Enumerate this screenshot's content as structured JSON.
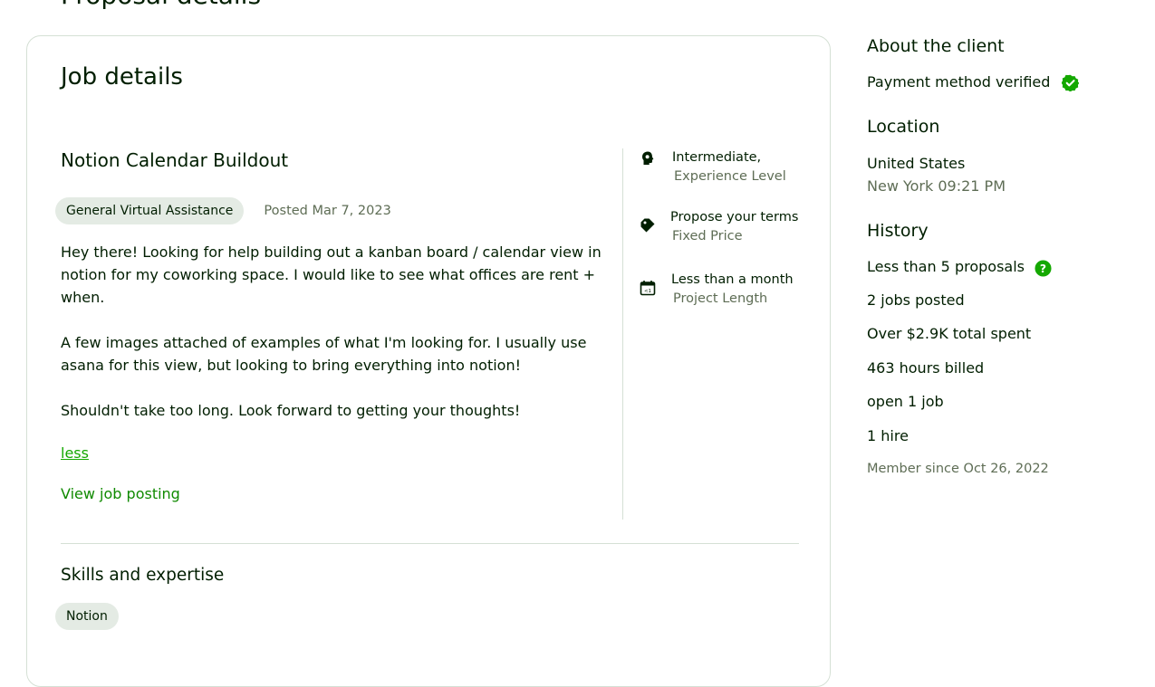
{
  "page": {
    "heading": "Proposal details"
  },
  "job": {
    "section_title": "Job details",
    "title": "Notion Calendar Buildout",
    "category": "General Virtual Assistance",
    "posted": "Posted Mar 7, 2023",
    "description": [
      "Hey there! Looking for help building out a kanban board / calendar view in notion for my coworking space. I would like to see what offices are rent + when.",
      "A few images attached of examples of what I'm looking for. I usually use asana for this view, but looking to bring everything into notion!",
      "Shouldn't take too long. Look forward to getting your thoughts!"
    ],
    "less_label": "less",
    "view_posting_label": "View job posting",
    "side": [
      {
        "icon": "experience-level-icon",
        "title": "Intermediate,",
        "subtitle": "Experience Level"
      },
      {
        "icon": "price-tag-icon",
        "title": "Propose your terms",
        "subtitle": "Fixed Price"
      },
      {
        "icon": "calendar-icon",
        "title": "Less than a month",
        "subtitle": "Project Length"
      }
    ],
    "skills_title": "Skills and expertise",
    "skills": [
      "Notion"
    ]
  },
  "client": {
    "about_title": "About the client",
    "payment": "Payment method verified",
    "location_title": "Location",
    "country": "United States",
    "city_time": "New York 09:21 PM",
    "history_title": "History",
    "proposals": "Less than 5 proposals",
    "jobs_posted": "2 jobs posted",
    "total_spent": "Over $2.9K total spent",
    "hours": "463 hours billed",
    "open_jobs": "open 1 job",
    "hires": "1 hire",
    "member_since": "Member since Oct 26, 2022"
  },
  "colors": {
    "accent": "#14a800",
    "link": "#108a00",
    "chip_bg": "#e4ebe4",
    "muted": "#5e6d55",
    "text": "#001e00"
  }
}
